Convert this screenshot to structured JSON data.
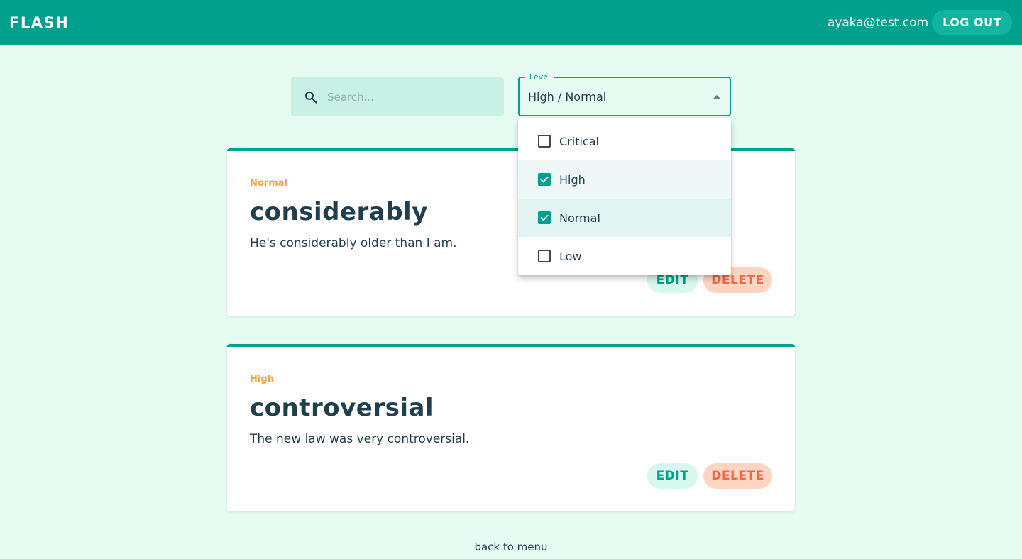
{
  "header": {
    "brand": "FLASH",
    "user_email": "ayaka@test.com",
    "logout_label": "LOG OUT"
  },
  "search": {
    "placeholder": "Search...",
    "value": ""
  },
  "level_filter": {
    "label": "Level",
    "value": "High / Normal",
    "options": [
      {
        "label": "Critical",
        "checked": false
      },
      {
        "label": "High",
        "checked": true
      },
      {
        "label": "Normal",
        "checked": true
      },
      {
        "label": "Low",
        "checked": false
      }
    ]
  },
  "cards": [
    {
      "level": "Normal",
      "word": "considerably",
      "sentence": "He's considerably older than I am.",
      "edit_label": "EDIT",
      "delete_label": "DELETE"
    },
    {
      "level": "High",
      "word": "controversial",
      "sentence": "The new law was very controversial.",
      "edit_label": "EDIT",
      "delete_label": "DELETE"
    }
  ],
  "footer": {
    "back_label": "back to menu"
  },
  "colors": {
    "primary": "#00a08f",
    "background": "#e6fcf2",
    "level_text": "#f7a23e",
    "delete_text": "#ef6a43"
  }
}
